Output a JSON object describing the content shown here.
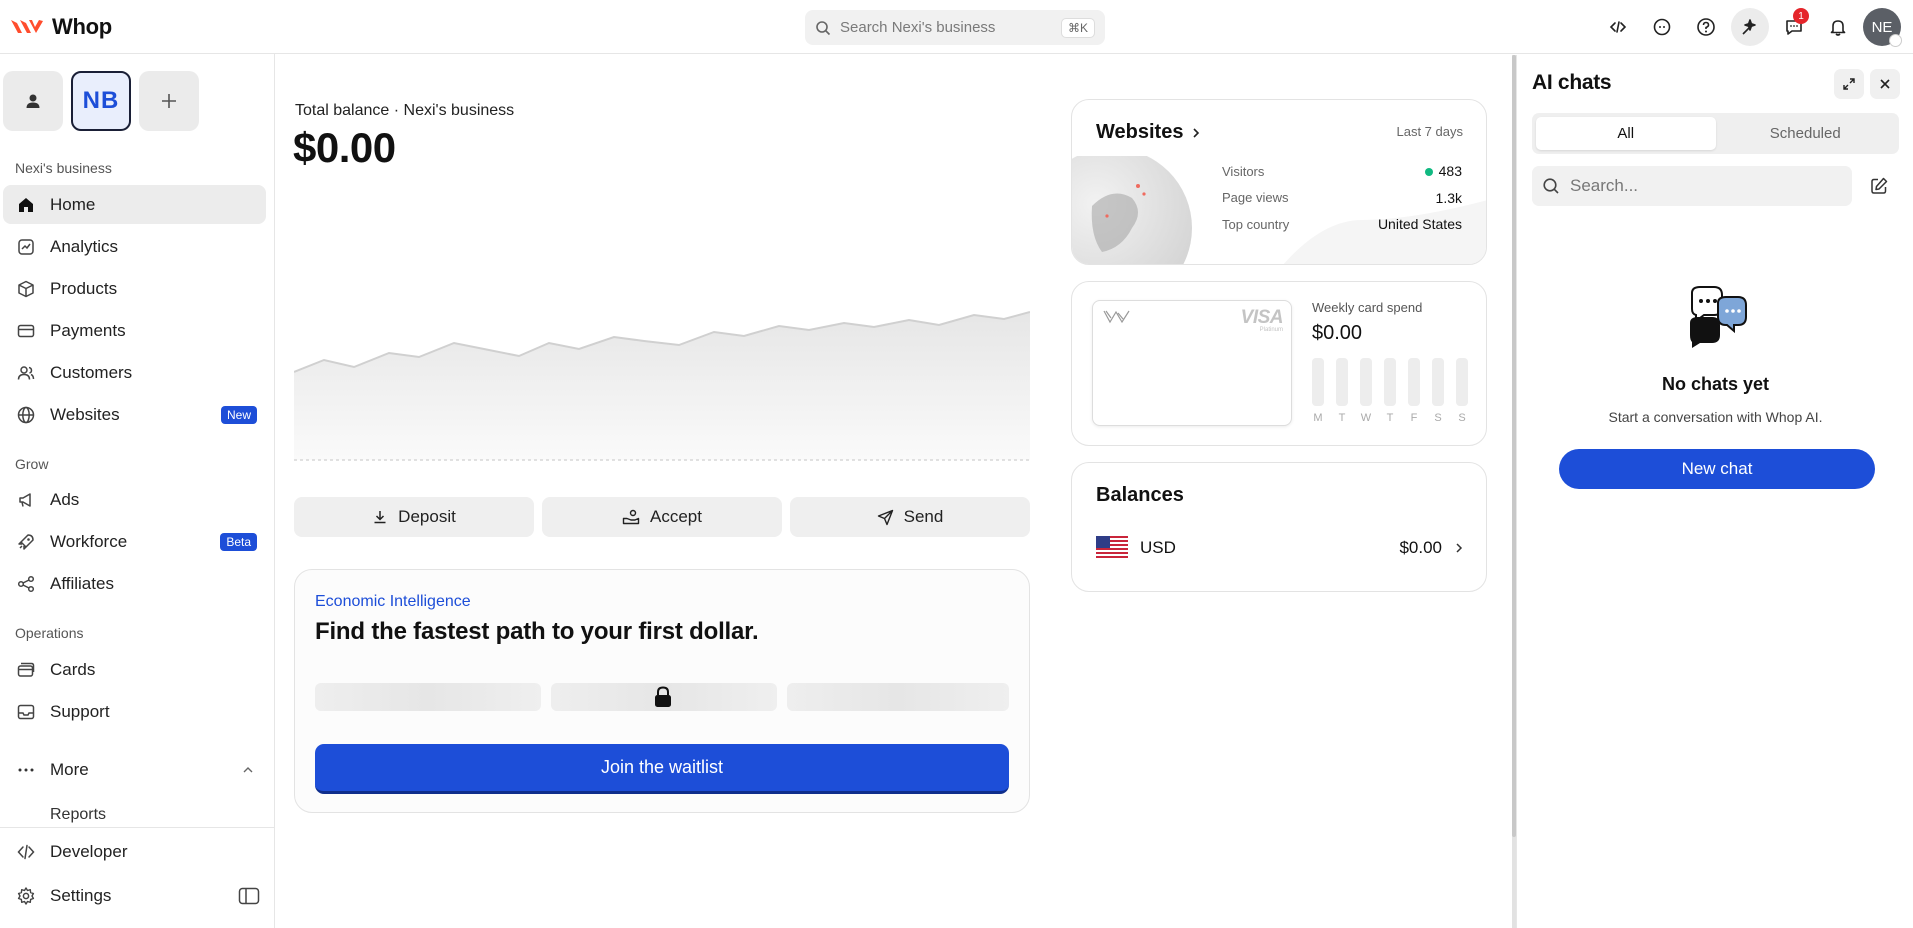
{
  "brand": {
    "name": "Whop",
    "accent": "#1d4ed8"
  },
  "search": {
    "placeholder": "Search Nexi's business",
    "shortcut": "⌘K"
  },
  "header": {
    "icons": [
      "code-icon",
      "chat-bubble-icon",
      "help-icon",
      "sparkle-icon",
      "messages-icon",
      "bell-icon"
    ],
    "messages_badge": "1",
    "avatar_initials": "NE"
  },
  "sidebar": {
    "workspace_initials": "NB",
    "section_business": "Nexi's business",
    "items_main": [
      {
        "label": "Home",
        "icon": "home-icon"
      },
      {
        "label": "Analytics",
        "icon": "analytics-icon"
      },
      {
        "label": "Products",
        "icon": "box-icon"
      },
      {
        "label": "Payments",
        "icon": "card-icon"
      },
      {
        "label": "Customers",
        "icon": "users-icon"
      },
      {
        "label": "Websites",
        "icon": "globe-icon",
        "badge": "New"
      }
    ],
    "section_grow": "Grow",
    "items_grow": [
      {
        "label": "Ads",
        "icon": "megaphone-icon"
      },
      {
        "label": "Workforce",
        "icon": "rocket-icon",
        "badge": "Beta"
      },
      {
        "label": "Affiliates",
        "icon": "share-icon"
      }
    ],
    "section_operations": "Operations",
    "items_operations": [
      {
        "label": "Cards",
        "icon": "cards-icon"
      },
      {
        "label": "Support",
        "icon": "inbox-icon"
      }
    ],
    "more_label": "More",
    "reports_label": "Reports",
    "developer_label": "Developer",
    "settings_label": "Settings"
  },
  "balance": {
    "label": "Total balance · Nexi's business",
    "value": "$0.00"
  },
  "actions": {
    "deposit": "Deposit",
    "accept": "Accept",
    "send": "Send"
  },
  "economic_intelligence": {
    "kicker": "Economic Intelligence",
    "title": "Find the fastest path to your first dollar.",
    "cta": "Join the waitlist"
  },
  "websites_card": {
    "title": "Websites",
    "range": "Last 7 days",
    "visitors_label": "Visitors",
    "visitors_value": "483",
    "pageviews_label": "Page views",
    "pageviews_value": "1.3k",
    "country_label": "Top country",
    "country_value": "United States"
  },
  "card_spend": {
    "label": "Weekly card spend",
    "value": "$0.00",
    "days": [
      "M",
      "T",
      "W",
      "T",
      "F",
      "S",
      "S"
    ],
    "card_brand": "VISA",
    "card_tier": "Platinum"
  },
  "balances": {
    "title": "Balances",
    "currency": "USD",
    "amount": "$0.00"
  },
  "ai_panel": {
    "title": "AI chats",
    "tab_all": "All",
    "tab_scheduled": "Scheduled",
    "search_placeholder": "Search...",
    "empty_title": "No chats yet",
    "empty_sub": "Start a conversation with Whop AI.",
    "new_chat": "New chat"
  }
}
